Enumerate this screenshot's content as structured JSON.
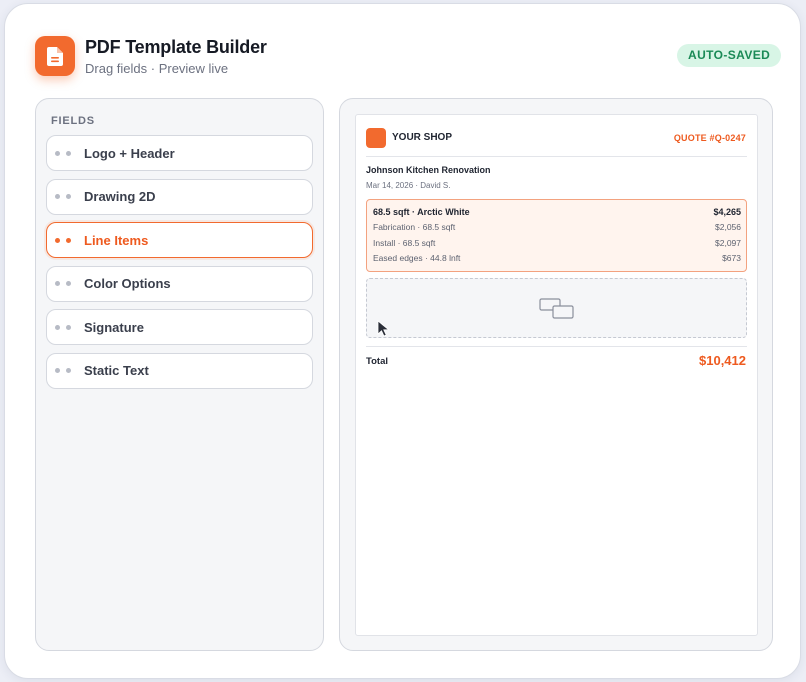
{
  "app": {
    "title": "PDF Template Builder",
    "subtitle": "Drag fields · Preview live",
    "status_badge": "AUTO-SAVED",
    "icon": "document-icon",
    "accent_color": "#f26a2e"
  },
  "fields": {
    "heading": "FIELDS",
    "items": [
      {
        "label": "Logo + Header",
        "active": false
      },
      {
        "label": "Drawing 2D",
        "active": false
      },
      {
        "label": "Line Items",
        "active": true
      },
      {
        "label": "Color Options",
        "active": false
      },
      {
        "label": "Signature",
        "active": false
      },
      {
        "label": "Static Text",
        "active": false
      }
    ]
  },
  "preview": {
    "shop_name": "YOUR SHOP",
    "quote_number": "QUOTE #Q-0247",
    "project_name": "Johnson Kitchen Renovation",
    "project_meta": "Mar 14, 2026 · David S.",
    "line_items": [
      {
        "label": "68.5 sqft · Arctic White",
        "amount": "$4,265"
      },
      {
        "label": "Fabrication · 68.5 sqft",
        "amount": "$2,056"
      },
      {
        "label": "Install · 68.5 sqft",
        "amount": "$2,097"
      },
      {
        "label": "Eased edges · 44.8 lnft",
        "amount": "$673"
      }
    ],
    "total_label": "Total",
    "total_value": "$10,412"
  }
}
